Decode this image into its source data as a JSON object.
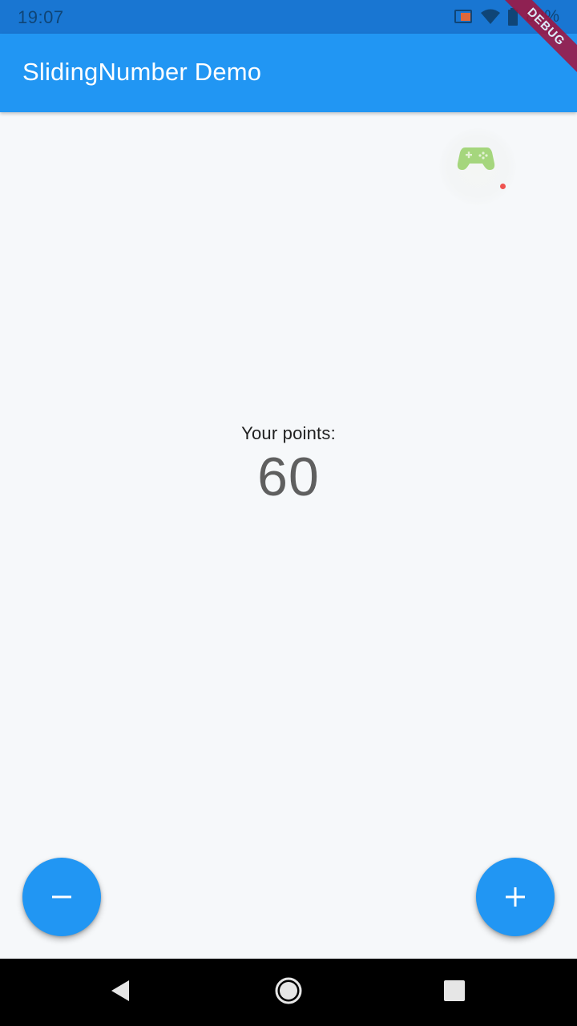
{
  "status_bar": {
    "time": "19:07",
    "battery": "82%",
    "icons": [
      "cast-icon",
      "wifi-icon",
      "battery-icon"
    ]
  },
  "app_bar": {
    "title": "SlidingNumber Demo",
    "color": "#2196f3"
  },
  "debug_banner": {
    "label": "DEBUG"
  },
  "overlay": {
    "icon": "gamepad-icon",
    "recording_dot_color": "#ef5350"
  },
  "counter": {
    "label": "Your points:",
    "value": "60"
  },
  "fabs": {
    "decrement_icon": "minus-icon",
    "increment_icon": "plus-icon",
    "color": "#2196f3"
  },
  "nav_bar": {
    "buttons": [
      "back-icon",
      "home-icon",
      "recents-icon"
    ]
  }
}
